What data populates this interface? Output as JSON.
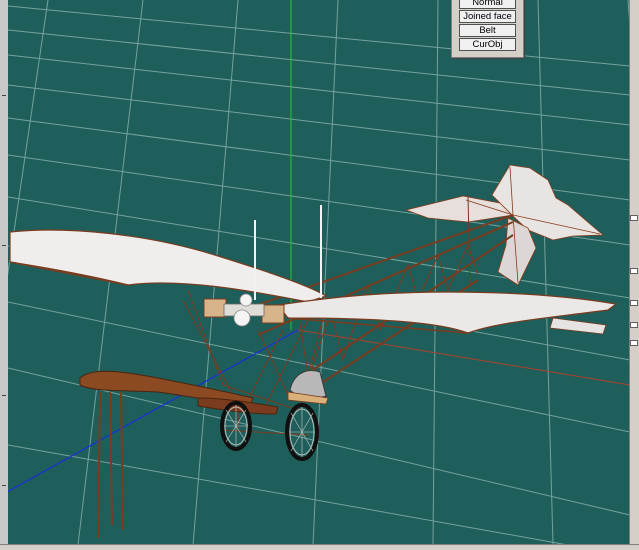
{
  "mode_panel": {
    "buttons": [
      {
        "label": "Normal"
      },
      {
        "label": "Joined face"
      },
      {
        "label": "Belt"
      },
      {
        "label": "CurObj"
      }
    ]
  },
  "viewport": {
    "background_color": "#1f5f5b",
    "grid_color": "#7fa9a4",
    "axis_colors": {
      "y": "#22cc22",
      "z": "#1a2fd8",
      "x": "#b0402a"
    },
    "model": "monoplane"
  }
}
